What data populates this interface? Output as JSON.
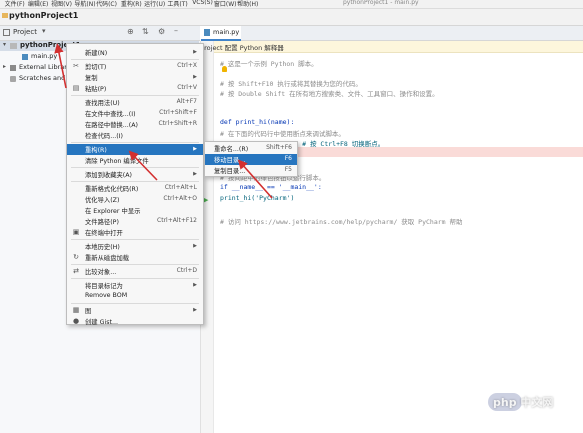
{
  "menubar": {
    "items": [
      "文件(F)",
      "编辑(E)",
      "视图(V)",
      "导航(N)",
      "代码(C)",
      "重构(R)",
      "运行(U)",
      "工具(T)",
      "VCS(S)",
      "窗口(W)",
      "帮助(H)"
    ],
    "window_title": "pythonProject1 - main.py"
  },
  "navbar": {
    "project": "pythonProject1"
  },
  "project_panel": {
    "header_label": "Project",
    "tree": [
      {
        "label": "pythonProject1",
        "bold": true
      },
      {
        "label": "main.py"
      },
      {
        "label": "External Librar"
      },
      {
        "label": "Scratches and C"
      }
    ]
  },
  "editor": {
    "tab": "main.py",
    "notice": "project 配置 Python 解释器",
    "lines": [
      "# 这是一个示例 Python 脚本。",
      "",
      "# 按 Shift+F10 执行或将其替换为您的代码。",
      "# 按 Double Shift 在所有地方搜索类、文件、工具窗口、操作和设置。",
      "",
      "",
      "def print_hi(name):",
      "    # 在下面的代码行中使用断点来调试脚本。",
      "    print(f'Hi, {name}')  # 按 Ctrl+F8 切换断点。",
      "",
      "",
      "# 按间距中的绿色按钮以运行脚本。",
      "if __name__ == '__main__':",
      "    print_hi('PyCharm')",
      "",
      "# 访问 https://www.jetbrains.com/help/pycharm/ 获取 PyCharm 帮助"
    ]
  },
  "context_menu": {
    "items": [
      {
        "label": "新建(N)",
        "shortcut": "",
        "submenu": true,
        "icon": ""
      },
      {
        "sep": true
      },
      {
        "label": "剪切(T)",
        "shortcut": "Ctrl+X",
        "icon": "scissors-icon"
      },
      {
        "label": "复制",
        "shortcut": "",
        "submenu": true,
        "icon": ""
      },
      {
        "label": "粘贴(P)",
        "shortcut": "Ctrl+V",
        "icon": "paste-icon"
      },
      {
        "sep": true
      },
      {
        "label": "查找用法(U)",
        "shortcut": "Alt+F7",
        "icon": ""
      },
      {
        "label": "在文件中查找...(I)",
        "shortcut": "Ctrl+Shift+F",
        "icon": ""
      },
      {
        "label": "在路径中替换...(A)",
        "shortcut": "Ctrl+Shift+R",
        "icon": ""
      },
      {
        "label": "检查代码...(I)",
        "shortcut": "",
        "icon": ""
      },
      {
        "sep": true
      },
      {
        "label": "重构(R)",
        "shortcut": "",
        "submenu": true,
        "icon": "",
        "highlight": true
      },
      {
        "label": "清除 Python 编译文件",
        "shortcut": "",
        "icon": ""
      },
      {
        "sep": true
      },
      {
        "label": "添加到收藏夹(A)",
        "shortcut": "",
        "submenu": true,
        "icon": ""
      },
      {
        "sep": true
      },
      {
        "label": "重新格式化代码(R)",
        "shortcut": "Ctrl+Alt+L",
        "icon": ""
      },
      {
        "label": "优化导入(Z)",
        "shortcut": "Ctrl+Alt+O",
        "icon": ""
      },
      {
        "label": "在 Explorer 中显示",
        "shortcut": "",
        "icon": ""
      },
      {
        "label": "文件路径(P)",
        "shortcut": "Ctrl+Alt+F12",
        "icon": ""
      },
      {
        "label": "在终端中打开",
        "shortcut": "",
        "icon": "terminal-icon"
      },
      {
        "sep": true
      },
      {
        "label": "本地历史(H)",
        "shortcut": "",
        "submenu": true,
        "icon": ""
      },
      {
        "label": "重新从磁盘加载",
        "shortcut": "",
        "icon": "reload-icon"
      },
      {
        "sep": true
      },
      {
        "label": "比较对象...",
        "shortcut": "Ctrl+D",
        "icon": "compare-icon"
      },
      {
        "sep": true
      },
      {
        "label": "将目录标记为",
        "shortcut": "",
        "submenu": true,
        "icon": ""
      },
      {
        "label": "Remove BOM",
        "shortcut": "",
        "icon": ""
      },
      {
        "sep": true
      },
      {
        "label": "图",
        "shortcut": "",
        "submenu": true,
        "icon": "diagram-icon"
      },
      {
        "label": "创建 Gist...",
        "shortcut": "",
        "icon": "github-icon"
      }
    ]
  },
  "submenu": {
    "items": [
      {
        "label": "重命名...(R)",
        "shortcut": "Shift+F6"
      },
      {
        "label": "移动目录...",
        "shortcut": "F6",
        "highlight": true
      },
      {
        "label": "复制目录...",
        "shortcut": "F5"
      }
    ]
  },
  "watermark": "php 中文网",
  "colors": {
    "highlight": "#2675bf",
    "arrow": "#d32f2f",
    "breakpoint_line": "#fadbd8"
  }
}
